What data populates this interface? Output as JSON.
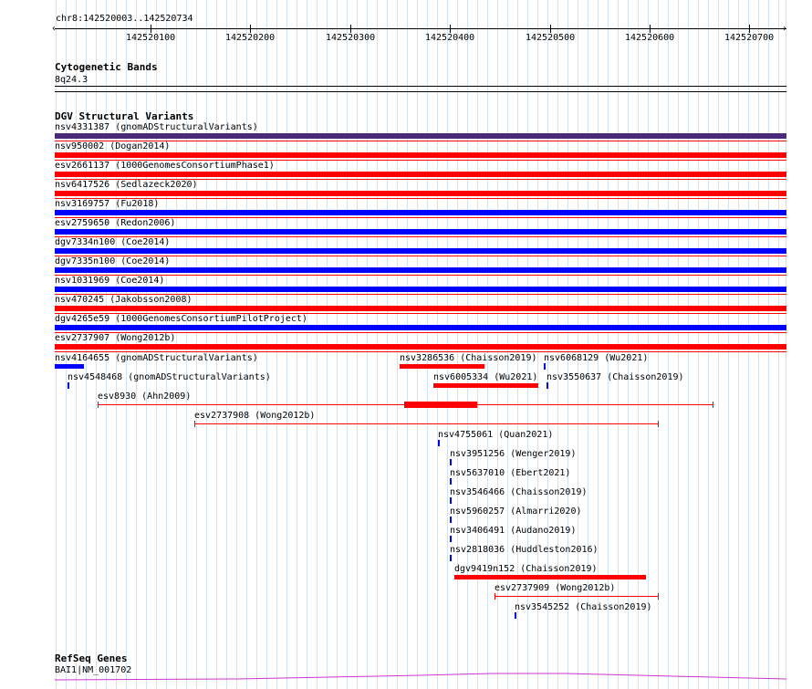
{
  "ruler": {
    "location": "chr8:142520003..142520734",
    "tick_labels": [
      "142520100",
      "142520200",
      "142520300",
      "142520400",
      "142520500",
      "142520600",
      "142520700"
    ]
  },
  "cytoband": {
    "title": "Cytogenetic Bands",
    "band": "8q24.3"
  },
  "dgv": {
    "title": "DGV Structural Variants",
    "full_rows": [
      {
        "label": "nsv4331387 (gnomADStructuralVariants)",
        "color": "#4a2a7a"
      },
      {
        "label": "nsv950002 (Dogan2014)",
        "color": "#ff0000"
      },
      {
        "label": "esv2661137 (1000GenomesConsortiumPhase1)",
        "color": "#ff0000"
      },
      {
        "label": "nsv6417526 (Sedlazeck2020)",
        "color": "#ff0000"
      },
      {
        "label": "nsv3169757 (Fu2018)",
        "color": "#0000ff"
      },
      {
        "label": "esv2759650 (Redon2006)",
        "color": "#0000ff"
      },
      {
        "label": "dgv7334n100 (Coe2014)",
        "color": "#0000ff"
      },
      {
        "label": "dgv7335n100 (Coe2014)",
        "color": "#0000ff"
      },
      {
        "label": "nsv1031969 (Coe2014)",
        "color": "#0000ff"
      },
      {
        "label": "nsv470245 (Jakobsson2008)",
        "color": "#ff0000"
      },
      {
        "label": "dgv4265e59 (1000GenomesConsortiumPilotProject)",
        "color": "#0000ff"
      },
      {
        "label": "esv2737907 (Wong2012b)",
        "color": "#ff0000"
      }
    ],
    "packed": {
      "nsv4164655": "nsv4164655 (gnomADStructuralVariants)",
      "nsv3286536": "nsv3286536 (Chaisson2019)",
      "nsv6068129": "nsv6068129 (Wu2021)",
      "nsv4548468": "nsv4548468 (gnomADStructuralVariants)",
      "nsv6005334": "nsv6005334 (Wu2021)",
      "nsv3550637": "nsv3550637 (Chaisson2019)",
      "esv8930": "esv8930 (Ahn2009)",
      "esv2737908": "esv2737908 (Wong2012b)",
      "nsv4755061": "nsv4755061 (Quan2021)",
      "nsv3951256": "nsv3951256 (Wenger2019)",
      "nsv5637010": "nsv5637010 (Ebert2021)",
      "nsv3546466": "nsv3546466 (Chaisson2019)",
      "nsv5960257": "nsv5960257 (Almarri2020)",
      "nsv3406491": "nsv3406491 (Audano2019)",
      "nsv2818036": "nsv2818036 (Huddleston2016)",
      "dgv9419n152": "dgv9419n152 (Chaisson2019)",
      "esv2737909": "esv2737909 (Wong2012b)",
      "nsv3545252": "nsv3545252 (Chaisson2019)"
    }
  },
  "refseq": {
    "title": "RefSeq Genes",
    "gene": "BAI1|NM_001702"
  },
  "colors": {
    "gain": "#0000ff",
    "loss": "#ff0000",
    "gain_loss": "#4a2a7a",
    "grid": "#cfe3f2",
    "gene": "#cc33cc"
  }
}
